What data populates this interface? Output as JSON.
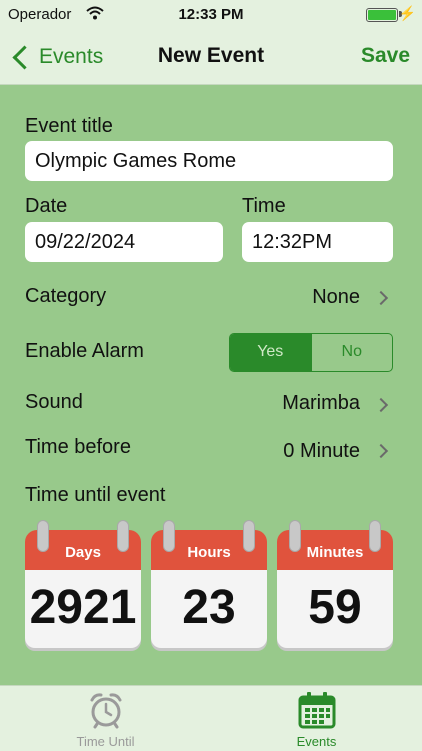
{
  "status_bar": {
    "carrier": "Operador",
    "time": "12:33 PM"
  },
  "navbar": {
    "back_label": "Events",
    "title": "New Event",
    "save_label": "Save"
  },
  "form": {
    "title_label": "Event title",
    "title_value": "Olympic Games Rome",
    "date_label": "Date",
    "date_value": "09/22/2024",
    "time_label": "Time",
    "time_value": "12:32PM",
    "category_label": "Category",
    "category_value": "None",
    "alarm_label": "Enable Alarm",
    "alarm_yes": "Yes",
    "alarm_no": "No",
    "sound_label": "Sound",
    "sound_value": "Marimba",
    "time_before_label": "Time before",
    "time_before_value": "0 Minute",
    "countdown_label": "Time until event"
  },
  "countdown": [
    {
      "unit": "Days",
      "value": "2921"
    },
    {
      "unit": "Hours",
      "value": "23"
    },
    {
      "unit": "Minutes",
      "value": "59"
    }
  ],
  "tabbar": {
    "tabs": [
      {
        "label": "Time Until",
        "icon": "alarm-clock-icon",
        "active": false
      },
      {
        "label": "Events",
        "icon": "calendar-icon",
        "active": true
      }
    ]
  },
  "colors": {
    "accent": "#2a8a2a",
    "background": "#98c98b",
    "bar": "#e4f1df",
    "calendar_header": "#e0533d",
    "inactive_tab": "#9a9a9a"
  }
}
